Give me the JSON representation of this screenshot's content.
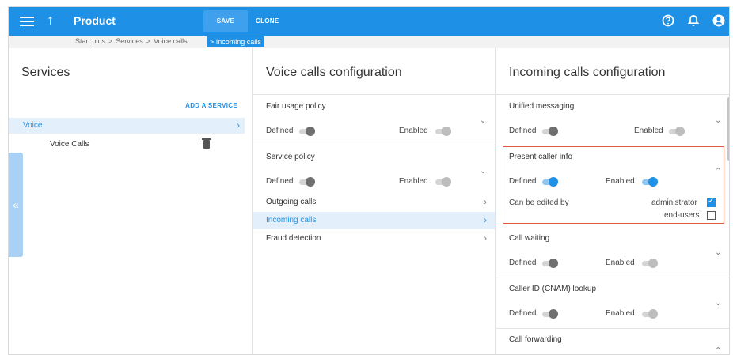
{
  "topbar": {
    "title": "Product",
    "save_label": "SAVE",
    "clone_label": "CLONE"
  },
  "breadcrumb": {
    "items": [
      "Start plus",
      ">",
      "Services",
      ">",
      "Voice calls"
    ],
    "current": "> Incoming calls"
  },
  "services": {
    "heading": "Services",
    "add_label": "ADD A SERVICE",
    "voice": "Voice",
    "voice_calls": "Voice Calls"
  },
  "voice_config": {
    "heading": "Voice calls configuration",
    "fair_usage": {
      "title": "Fair usage policy",
      "defined": "Defined",
      "enabled": "Enabled"
    },
    "service_policy": {
      "title": "Service policy",
      "defined": "Defined",
      "enabled": "Enabled"
    },
    "nav": [
      "Outgoing calls",
      "Incoming calls",
      "Fraud detection"
    ]
  },
  "incoming_config": {
    "heading": "Incoming calls configuration",
    "unified": {
      "title": "Unified messaging",
      "defined": "Defined",
      "enabled": "Enabled"
    },
    "present": {
      "title": "Present caller info",
      "defined": "Defined",
      "enabled": "Enabled",
      "edited_by": "Can be edited by",
      "admin": "administrator",
      "endusers": "end-users",
      "admin_checked": true,
      "endusers_checked": false
    },
    "waiting": {
      "title": "Call waiting",
      "defined": "Defined",
      "enabled": "Enabled"
    },
    "cnam": {
      "title": "Caller ID (CNAM) lookup",
      "defined": "Defined",
      "enabled": "Enabled"
    },
    "forwarding": {
      "title": "Call forwarding"
    }
  },
  "colors": {
    "accent": "#1e90e6",
    "highlight_border": "#e15c3e",
    "selected_row": "#e3f0fb"
  },
  "icons": {
    "menu": "hamburger-icon",
    "up": "arrow-up-icon",
    "help": "help-icon",
    "bell": "bell-icon",
    "user": "account-icon"
  }
}
